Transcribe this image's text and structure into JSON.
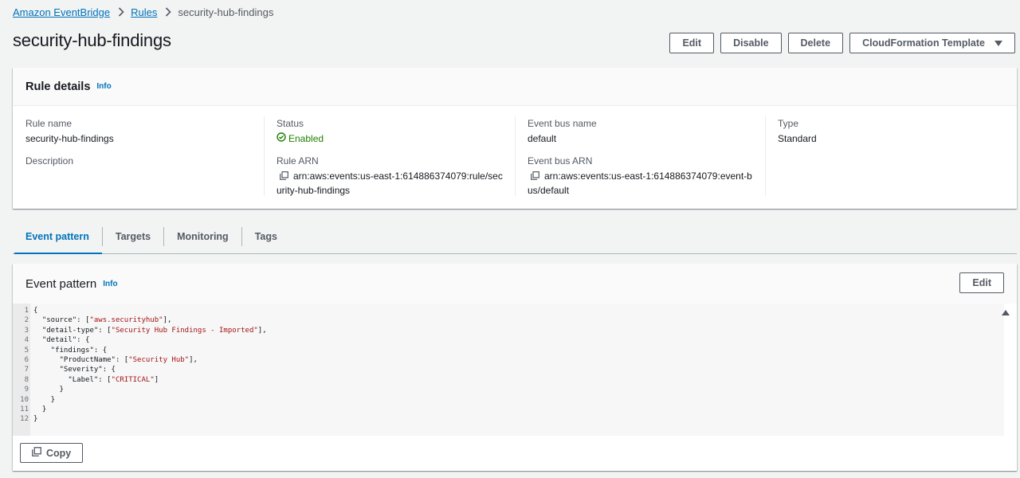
{
  "breadcrumb": {
    "items": [
      "Amazon EventBridge",
      "Rules"
    ],
    "current": "security-hub-findings"
  },
  "page": {
    "title": "security-hub-findings",
    "actions": {
      "edit": "Edit",
      "disable": "Disable",
      "delete": "Delete",
      "cloudformation": "CloudFormation Template"
    }
  },
  "rule_details": {
    "title": "Rule details",
    "info": "Info",
    "rule_name_label": "Rule name",
    "rule_name": "security-hub-findings",
    "description_label": "Description",
    "status_label": "Status",
    "status": "Enabled",
    "rule_arn_label": "Rule ARN",
    "rule_arn": "arn:aws:events:us-east-1:614886374079:rule/security-hub-findings",
    "event_bus_name_label": "Event bus name",
    "event_bus_name": "default",
    "event_bus_arn_label": "Event bus ARN",
    "event_bus_arn": "arn:aws:events:us-east-1:614886374079:event-bus/default",
    "type_label": "Type",
    "type": "Standard"
  },
  "tabs": [
    "Event pattern",
    "Targets",
    "Monitoring",
    "Tags"
  ],
  "event_pattern": {
    "title": "Event pattern",
    "info": "Info",
    "edit": "Edit",
    "copy": "Copy",
    "lines": [
      {
        "n": "1",
        "parts": [
          [
            "p",
            "{"
          ]
        ]
      },
      {
        "n": "2",
        "parts": [
          [
            "p",
            "  \"source\": ["
          ],
          [
            "s",
            "\"aws.securityhub\""
          ],
          [
            "p",
            "],"
          ]
        ]
      },
      {
        "n": "3",
        "parts": [
          [
            "p",
            "  \"detail-type\": ["
          ],
          [
            "s",
            "\"Security Hub Findings - Imported\""
          ],
          [
            "p",
            "],"
          ]
        ]
      },
      {
        "n": "4",
        "parts": [
          [
            "p",
            "  \"detail\": {"
          ]
        ]
      },
      {
        "n": "5",
        "parts": [
          [
            "p",
            "    \"findings\": {"
          ]
        ]
      },
      {
        "n": "6",
        "parts": [
          [
            "p",
            "      \"ProductName\": ["
          ],
          [
            "s",
            "\"Security Hub\""
          ],
          [
            "p",
            "],"
          ]
        ]
      },
      {
        "n": "7",
        "parts": [
          [
            "p",
            "      \"Severity\": {"
          ]
        ]
      },
      {
        "n": "8",
        "parts": [
          [
            "p",
            "        \"Label\": ["
          ],
          [
            "s",
            "\"CRITICAL\""
          ],
          [
            "p",
            "]"
          ]
        ]
      },
      {
        "n": "9",
        "parts": [
          [
            "p",
            "      }"
          ]
        ]
      },
      {
        "n": "10",
        "parts": [
          [
            "p",
            "    }"
          ]
        ]
      },
      {
        "n": "11",
        "parts": [
          [
            "p",
            "  }"
          ]
        ]
      },
      {
        "n": "12",
        "parts": [
          [
            "p",
            "}"
          ]
        ]
      }
    ]
  },
  "colors": {
    "link": "#0073bb",
    "success": "#1d8102",
    "string": "#a31515"
  }
}
